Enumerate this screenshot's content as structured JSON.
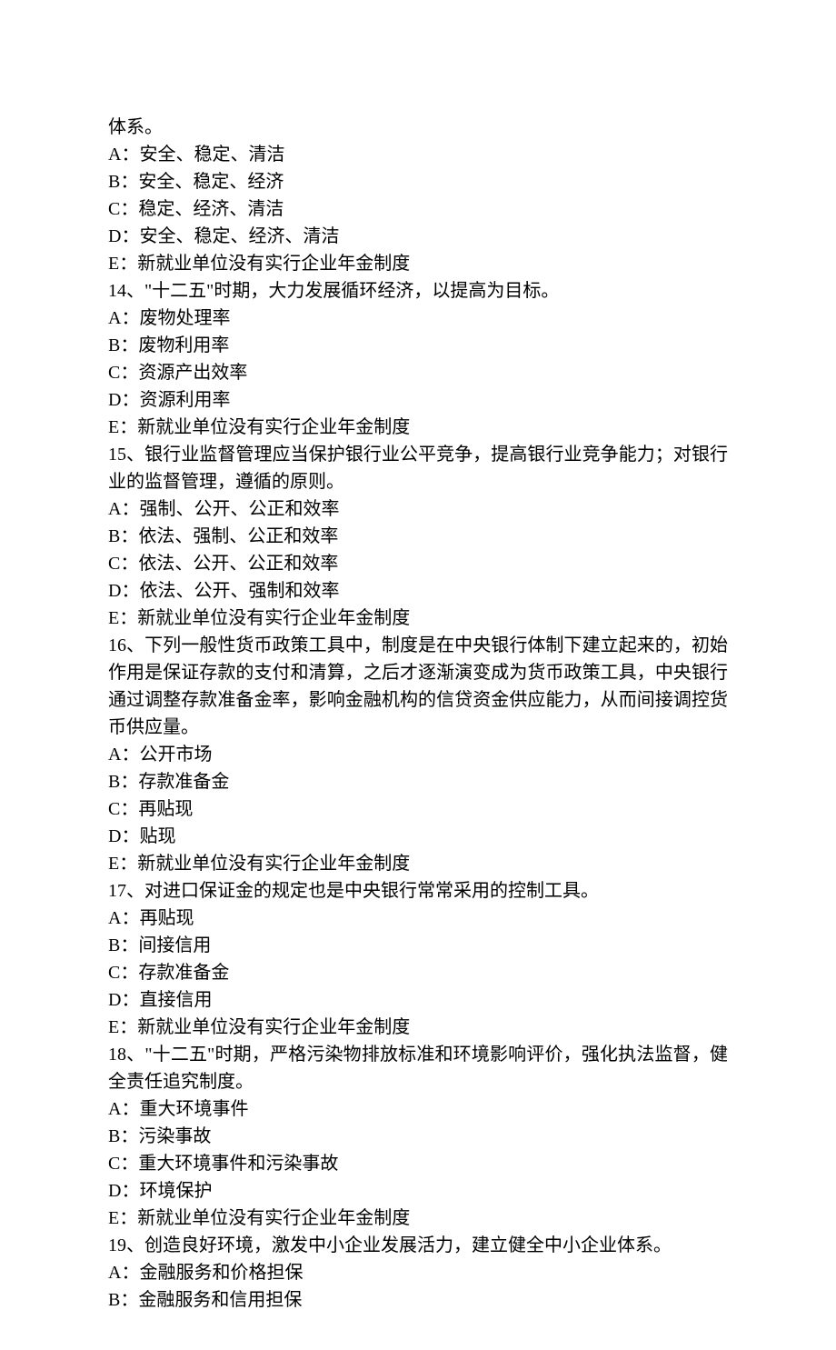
{
  "lines": [
    "体系。",
    "A：安全、稳定、清洁",
    "B：安全、稳定、经济",
    "C：稳定、经济、清洁",
    "D：安全、稳定、经济、清洁",
    "E：新就业单位没有实行企业年金制度",
    "14、\"十二五\"时期，大力发展循环经济，以提高为目标。",
    "A：废物处理率",
    "B：废物利用率",
    "C：资源产出效率",
    "D：资源利用率",
    "E：新就业单位没有实行企业年金制度",
    "15、银行业监督管理应当保护银行业公平竞争，提高银行业竞争能力；对银行业的监督管理，遵循的原则。",
    "A：强制、公开、公正和效率",
    "B：依法、强制、公正和效率",
    "C：依法、公开、公正和效率",
    "D：依法、公开、强制和效率",
    "E：新就业单位没有实行企业年金制度",
    "16、下列一般性货币政策工具中，制度是在中央银行体制下建立起来的，初始作用是保证存款的支付和清算，之后才逐渐演变成为货币政策工具，中央银行通过调整存款准备金率，影响金融机构的信贷资金供应能力，从而间接调控货币供应量。",
    "A：公开市场",
    "B：存款准备金",
    "C：再贴现",
    "D：贴现",
    "E：新就业单位没有实行企业年金制度",
    "17、对进口保证金的规定也是中央银行常常采用的控制工具。",
    "A：再贴现",
    "B：间接信用",
    "C：存款准备金",
    "D：直接信用",
    "E：新就业单位没有实行企业年金制度",
    "18、\"十二五\"时期，严格污染物排放标准和环境影响评价，强化执法监督，健全责任追究制度。",
    "A：重大环境事件",
    "B：污染事故",
    "C：重大环境事件和污染事故",
    "D：环境保护",
    "E：新就业单位没有实行企业年金制度",
    "19、创造良好环境，激发中小企业发展活力，建立健全中小企业体系。",
    "A：金融服务和价格担保",
    "B：金融服务和信用担保"
  ]
}
